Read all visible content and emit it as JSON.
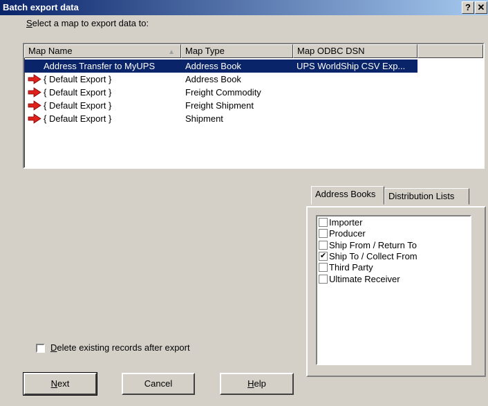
{
  "window": {
    "title": "Batch export data",
    "help_label": "?",
    "close_label": "✕"
  },
  "select_label": {
    "prefix_underline": "S",
    "rest": "elect a map to export data to:"
  },
  "columns": [
    "Map Name",
    "Map Type",
    "Map ODBC DSN",
    ""
  ],
  "sort_indicator": "▲",
  "rows": [
    {
      "name": "Address Transfer to MyUPS",
      "type": "Address Book",
      "dsn": "UPS WorldShip CSV Exp...",
      "selected": true
    },
    {
      "name": "{ Default Export }",
      "type": "Address Book",
      "dsn": ""
    },
    {
      "name": "{ Default Export }",
      "type": "Freight Commodity",
      "dsn": ""
    },
    {
      "name": "{ Default Export }",
      "type": "Freight Shipment",
      "dsn": ""
    },
    {
      "name": "{ Default Export }",
      "type": "Shipment",
      "dsn": ""
    }
  ],
  "tabs": [
    {
      "label": "Address Books",
      "active": true
    },
    {
      "label": "Distribution Lists",
      "active": false
    }
  ],
  "checklist": [
    {
      "label": "Importer",
      "checked": false
    },
    {
      "label": "Producer",
      "checked": false
    },
    {
      "label": "Ship From / Return To",
      "checked": false
    },
    {
      "label": "Ship To / Collect From",
      "checked": true
    },
    {
      "label": "Third Party",
      "checked": false
    },
    {
      "label": "Ultimate Receiver",
      "checked": false
    }
  ],
  "delete_option": {
    "underline": "D",
    "rest": "elete existing records after export",
    "checked": false
  },
  "buttons": {
    "next": {
      "underline": "N",
      "rest": "ext"
    },
    "cancel": "Cancel",
    "help": {
      "underline": "H",
      "rest": "elp"
    }
  },
  "colors": {
    "title_start": "#0a246a",
    "title_end": "#a6caf0",
    "selection": "#0a246a",
    "face": "#d4d0c8",
    "arrow_red": "#e0201a"
  },
  "icons": {
    "row_icon": "red-arrow-icon",
    "check": "checkmark-icon"
  }
}
